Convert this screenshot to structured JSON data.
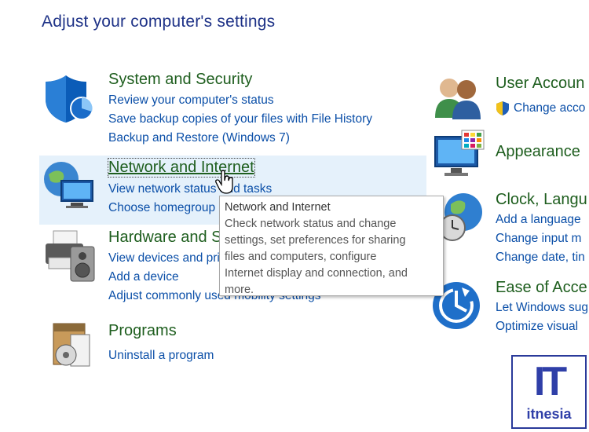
{
  "page_title": "Adjust your computer's settings",
  "categories": {
    "system_security": {
      "title": "System and Security",
      "links": [
        "Review your computer's status",
        "Save backup copies of your files with File History",
        "Backup and Restore (Windows 7)"
      ]
    },
    "network": {
      "title": "Network and Internet",
      "links": [
        "View network status and tasks",
        "Choose homegroup and sharing options"
      ]
    },
    "hardware": {
      "title": "Hardware and Sound",
      "links": [
        "View devices and printers",
        "Add a device",
        "Adjust commonly used mobility settings"
      ]
    },
    "programs": {
      "title": "Programs",
      "links": [
        "Uninstall a program"
      ]
    },
    "user_accounts": {
      "title": "User Accoun",
      "links": [
        "Change acco"
      ]
    },
    "appearance": {
      "title": "Appearance",
      "links": []
    },
    "clock": {
      "title": "Clock, Langu",
      "links": [
        "Add a language",
        "Change input m",
        "Change date, tin"
      ]
    },
    "ease": {
      "title": "Ease of Acce",
      "links": [
        "Let Windows sug",
        "Optimize visual"
      ]
    }
  },
  "tooltip": {
    "title": "Network and Internet",
    "lines": [
      "Check network status and change",
      "settings, set preferences for sharing",
      "files and computers, configure",
      "Internet display and connection, and",
      "more."
    ]
  },
  "logo": {
    "mark": "IT",
    "text": "itnesia"
  },
  "colors": {
    "title_blue": "#1e3287",
    "category_green": "#1e5e1e",
    "link_blue": "#0b4fa8",
    "hover_bg": "#e5f1fb"
  }
}
